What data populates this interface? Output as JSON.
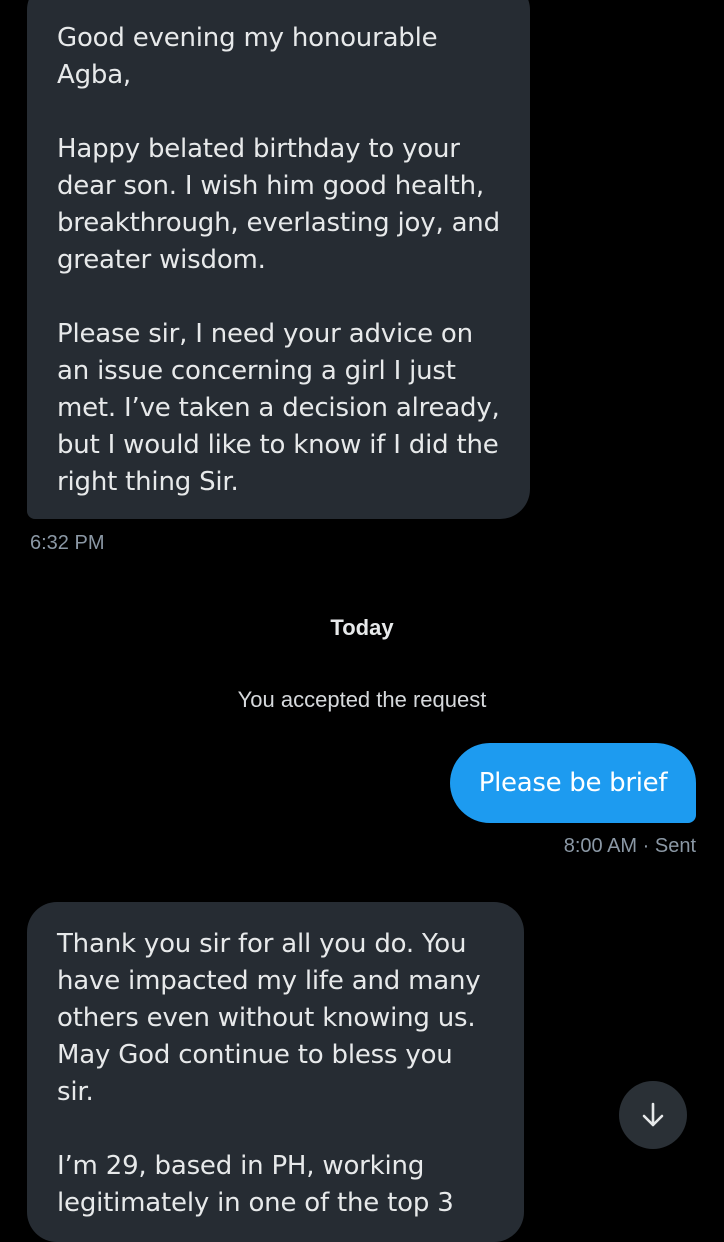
{
  "conversation": {
    "messages": [
      {
        "direction": "incoming",
        "paragraphs": [
          "Good evening my honourable Agba,",
          "Happy belated birthday to your dear son. I wish him good health, breakthrough, everlasting joy, and greater wisdom.",
          "Please sir, I need your advice on an issue concerning a girl I just met. I’ve taken a decision already, but I would like to know if I did the right thing Sir."
        ],
        "timestamp": "6:32 PM"
      },
      {
        "direction": "outgoing",
        "text": "Please be brief",
        "timestamp": "8:00 AM · Sent"
      },
      {
        "direction": "incoming",
        "paragraphs": [
          "Thank you sir for all you do. You have impacted my life and many others even without knowing us. May God continue to bless you sir.",
          "I’m 29, based in PH, working legitimately in one of the top 3"
        ]
      }
    ],
    "day_separator": "Today",
    "system_notice": "You accepted the request"
  },
  "controls": {
    "scroll_down_icon": "arrow-down-icon"
  },
  "colors": {
    "background": "#000000",
    "incoming_bubble": "#262c33",
    "outgoing_bubble": "#1d9bf0",
    "meta_text": "#8b98a5"
  }
}
